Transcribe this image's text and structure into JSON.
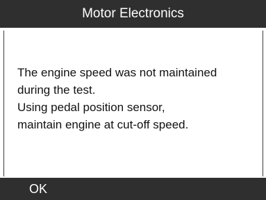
{
  "header": {
    "title": "Motor Electronics"
  },
  "message": {
    "lines": [
      "The engine speed was not maintained",
      "during the test.",
      "Using pedal position sensor,",
      "maintain engine at cut-off speed."
    ]
  },
  "footer": {
    "ok_label": "OK"
  },
  "colors": {
    "bar_background": "#2f2f2f",
    "bar_text": "#ffffff",
    "body_background": "#ffffff",
    "body_text": "#111111"
  }
}
